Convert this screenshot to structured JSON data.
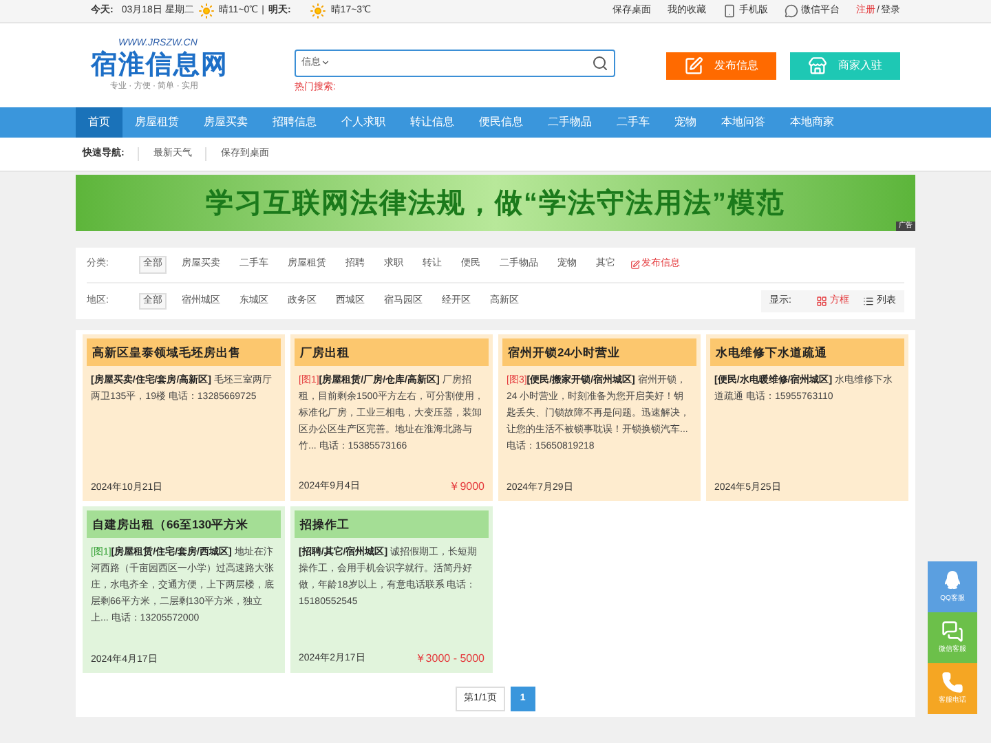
{
  "top_bar": {
    "today_label": "今天:",
    "date": "03月18日 星期二",
    "today_weather": "晴11~0℃",
    "separator": "|",
    "tomorrow_label": "明天:",
    "tomorrow_weather": "晴17~3℃",
    "links": [
      {
        "label": "保存桌面",
        "kind": "plain"
      },
      {
        "label": "我的收藏",
        "kind": "plain"
      },
      {
        "label": "手机版",
        "kind": "phone"
      },
      {
        "label": "微信平台",
        "kind": "wechat"
      }
    ],
    "register": "注册",
    "slash": "/",
    "login": "登录"
  },
  "header": {
    "logo_url": "WWW.JRSZW.CN",
    "logo_text": "宿淮信息网",
    "logo_slogan": "专业 · 方便 · 简单 · 实用",
    "search_scope": "信息",
    "hot_search_label": "热门搜索:",
    "buttons": [
      {
        "label": "发布信息",
        "kind": "post"
      },
      {
        "label": "商家入驻",
        "kind": "merchant"
      }
    ]
  },
  "nav": [
    {
      "label": "首页",
      "selected": true
    },
    {
      "label": "房屋租赁",
      "selected": false
    },
    {
      "label": "房屋买卖",
      "selected": false
    },
    {
      "label": "招聘信息",
      "selected": false
    },
    {
      "label": "个人求职",
      "selected": false
    },
    {
      "label": "转让信息",
      "selected": false
    },
    {
      "label": "便民信息",
      "selected": false
    },
    {
      "label": "二手物品",
      "selected": false
    },
    {
      "label": "二手车",
      "selected": false
    },
    {
      "label": "宠物",
      "selected": false
    },
    {
      "label": "本地问答",
      "selected": false
    },
    {
      "label": "本地商家",
      "selected": false
    }
  ],
  "quick_nav": {
    "label": "快速导航:",
    "links": [
      "最新天气",
      "保存到桌面"
    ]
  },
  "banner": {
    "text": "学习互联网法律法规，做“学法守法用法”模范",
    "ad_label": "广告"
  },
  "filters": {
    "category_label": "分类:",
    "categories": [
      {
        "label": "全部",
        "selected": true
      },
      {
        "label": "房屋买卖",
        "selected": false
      },
      {
        "label": "二手车",
        "selected": false
      },
      {
        "label": "房屋租赁",
        "selected": false
      },
      {
        "label": "招聘",
        "selected": false
      },
      {
        "label": "求职",
        "selected": false
      },
      {
        "label": "转让",
        "selected": false
      },
      {
        "label": "便民",
        "selected": false
      },
      {
        "label": "二手物品",
        "selected": false
      },
      {
        "label": "宠物",
        "selected": false
      },
      {
        "label": "其它",
        "selected": false
      }
    ],
    "post_link": "发布信息",
    "region_label": "地区:",
    "regions": [
      {
        "label": "全部",
        "selected": true
      },
      {
        "label": "宿州城区",
        "selected": false
      },
      {
        "label": "东城区",
        "selected": false
      },
      {
        "label": "政务区",
        "selected": false
      },
      {
        "label": "西城区",
        "selected": false
      },
      {
        "label": "宿马园区",
        "selected": false
      },
      {
        "label": "经开区",
        "selected": false
      },
      {
        "label": "高新区",
        "selected": false
      }
    ],
    "display_label": "显示:",
    "display_modes": [
      {
        "label": "方框",
        "kind": "grid",
        "selected": true
      },
      {
        "label": "列表",
        "kind": "list",
        "selected": false
      }
    ]
  },
  "listings": [
    {
      "title": "高新区皇泰领域毛坯房出售",
      "color": "#fcc76e",
      "category": "[房屋买卖/住宅/套房/高新区]",
      "description": "毛坯三室两厅两卫135平，19楼 电话：13285669725",
      "date": "2024年10月21日"
    },
    {
      "title": "厂房出租",
      "color": "#fcc76e",
      "tag": "[图1]",
      "category": "[房屋租赁/厂房/仓库/高新区]",
      "description": "厂房招租，目前剩余1500平方左右，可分割使用，标准化厂房，工业三相电，大变压器，装卸区办公区生产区完善。地址在淮海北路与竹... 电话：15385573166",
      "date": "2024年9月4日",
      "price": "￥9000"
    },
    {
      "title": "宿州开锁24小时营业",
      "color": "#fcc76e",
      "tag": "[图3]",
      "category": "[便民/搬家开锁/宿州城区]",
      "description": "宿州开锁，24 小时营业，时刻准备为您开启美好！钥匙丢失、门锁故障不再是问题。迅速解决，让您的生活不被锁事耽误！开锁换锁汽车... 电话：15650819218",
      "date": "2024年7月29日"
    },
    {
      "title": "水电维修下水道疏通",
      "color": "#fcc76e",
      "category": "[便民/水电暖维修/宿州城区]",
      "description": "水电维修下水道疏通 电话：15955763110",
      "date": "2024年5月25日"
    },
    {
      "title": "自建房出租（66至130平方米",
      "color": "#a4de95",
      "tag": "[图1]",
      "category": "[房屋租赁/住宅/套房/西城区]",
      "description": "地址在汴河西路（千亩园西区一小学）过高速路大张庄，水电齐全，交通方便，上下两层楼，底层剩66平方米，二层剩130平方米，独立上... 电话：13205572000",
      "date": "2024年4月17日"
    },
    {
      "title": "招操作工",
      "color": "#a4de95",
      "category": "[招聘/其它/宿州城区]",
      "description": "诚招假期工，长短期操作工，会用手机会识字就行。活简丹好做，年龄18岁以上，有意电话联系 电话：15180552545",
      "date": "2024年2月17日",
      "price": "￥3000 - 5000"
    }
  ],
  "pagination": {
    "info": "第1/1页",
    "pages": [
      {
        "label": "1",
        "selected": true
      }
    ]
  },
  "side_float": [
    {
      "label": "QQ客服",
      "kind": "qq"
    },
    {
      "label": "微信客服",
      "kind": "wechat"
    },
    {
      "label": "客服电话",
      "kind": "phone"
    }
  ]
}
